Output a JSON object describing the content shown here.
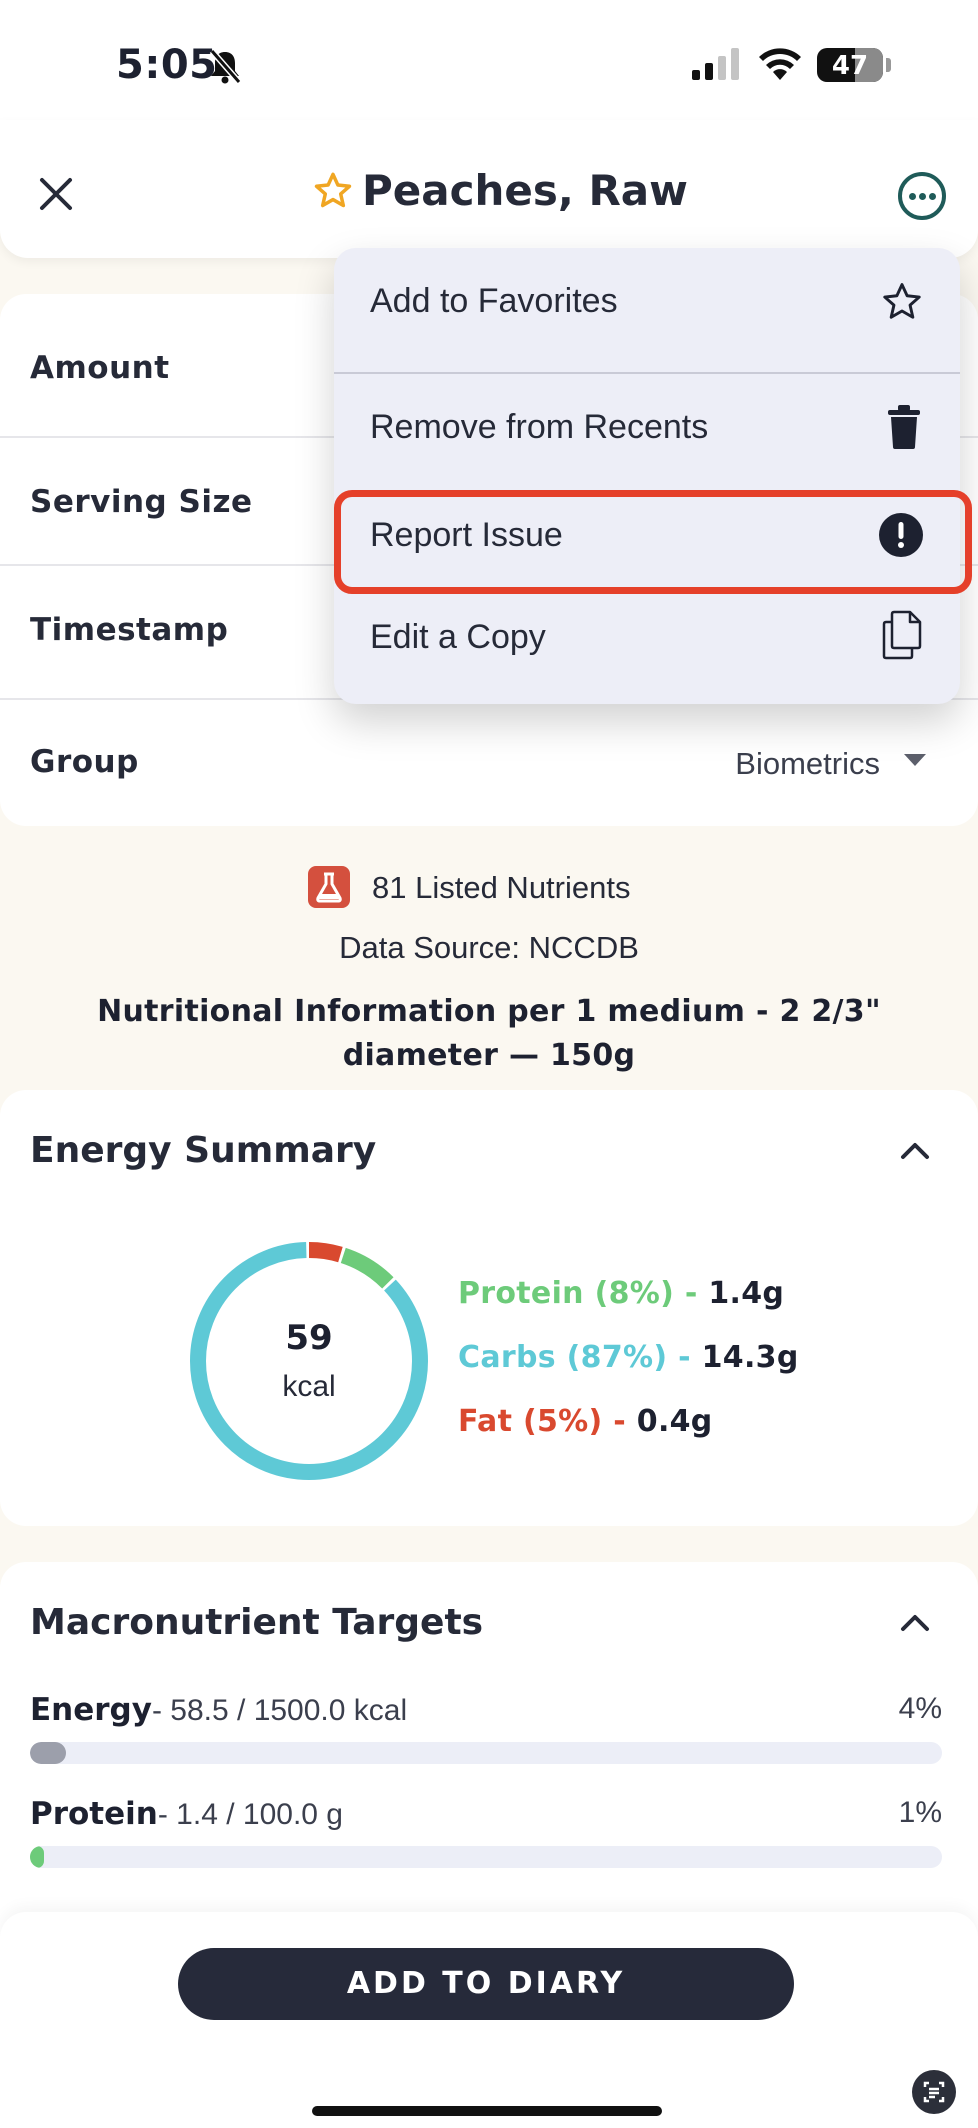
{
  "status_bar": {
    "time": "5:05",
    "battery": "47"
  },
  "header": {
    "title": "Peaches, Raw"
  },
  "fields": {
    "amount_label": "Amount",
    "serving_size_label": "Serving Size",
    "timestamp_label": "Timestamp",
    "group_label": "Group",
    "group_value": "Biometrics"
  },
  "info": {
    "nutrients_count": "81 Listed Nutrients",
    "data_source": "Data Source: NCCDB",
    "nutrition_info": "Nutritional Information per 1 medium - 2 2/3\" diameter — 150g"
  },
  "energy_summary": {
    "title": "Energy Summary",
    "kcal": "59",
    "kcal_unit": "kcal",
    "protein_label": "Protein (8%) -",
    "protein_value": "1.4g",
    "carbs_label": "Carbs (87%) -",
    "carbs_value": "14.3g",
    "fat_label": "Fat (5%) -",
    "fat_value": "0.4g",
    "colors": {
      "protein": "#6dcb7a",
      "carbs": "#5ec9d6",
      "fat": "#d9492f"
    },
    "percentages": {
      "protein": 8,
      "carbs": 87,
      "fat": 5
    }
  },
  "macronutrient_targets": {
    "title": "Macronutrient Targets",
    "rows": [
      {
        "name": "Energy",
        "detail": "- 58.5 / 1500.0 kcal",
        "pct": "4%",
        "progress": 0.04,
        "color": "#9c9fab"
      },
      {
        "name": "Protein",
        "detail": "- 1.4 / 100.0 g",
        "pct": "1%",
        "progress": 0.014,
        "color": "#6dcb7a"
      }
    ]
  },
  "footer": {
    "add_button": "ADD TO DIARY"
  },
  "menu": {
    "items": [
      {
        "label": "Add to Favorites",
        "icon": "star-outline-icon"
      },
      {
        "label": "Remove from Recents",
        "icon": "trash-icon"
      },
      {
        "label": "Report Issue",
        "icon": "exclamation-circle-icon"
      },
      {
        "label": "Edit a Copy",
        "icon": "copy-icon"
      }
    ],
    "highlighted": "Report Issue",
    "highlight_color": "#e5402a"
  }
}
